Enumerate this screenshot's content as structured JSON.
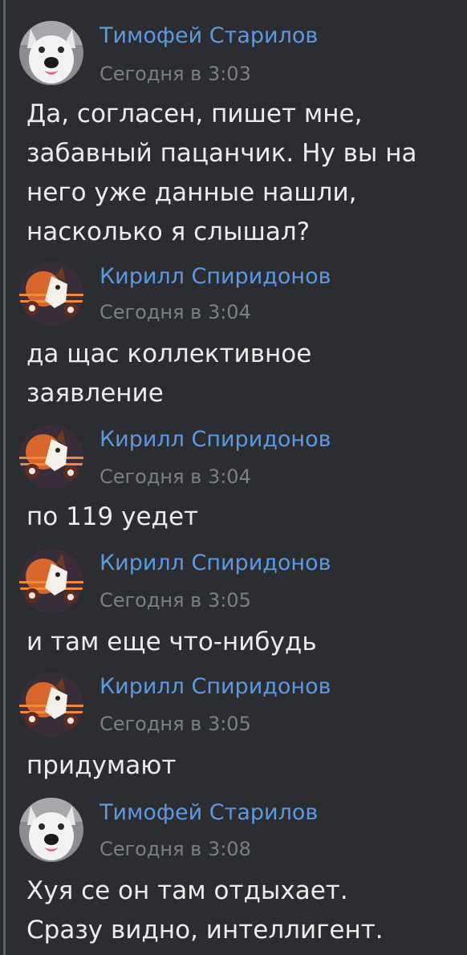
{
  "messages": [
    {
      "author": "Тимофей Старилов",
      "time": "Сегодня в 3:03",
      "text": "Да, согласен, пишет мне,\nзабавный пацанчик. Ну вы на\nнего уже данные нашли,\nнасколько я слышал?",
      "avatar": "husky-avatar"
    },
    {
      "author": "Кирилл Спиридонов",
      "time": "Сегодня в 3:04",
      "text": "да щас коллективное\nзаявление",
      "avatar": "fox-avatar"
    },
    {
      "author": "Кирилл Спиридонов",
      "time": "Сегодня в 3:04",
      "text": "по 119 уедет",
      "avatar": "fox-avatar"
    },
    {
      "author": "Кирилл Спиридонов",
      "time": "Сегодня в 3:05",
      "text": "и там еще что-нибудь",
      "avatar": "fox-avatar"
    },
    {
      "author": "Кирилл Спиридонов",
      "time": "Сегодня в 3:05",
      "text": "придумают",
      "avatar": "fox-avatar"
    },
    {
      "author": "Тимофей Старилов",
      "time": "Сегодня в 3:08",
      "text": "Хуя се он там отдыхает.\nСразу видно, интеллигент.",
      "avatar": "husky-avatar"
    }
  ],
  "colors": {
    "background": "#2c2d30",
    "author_link": "#5b9ae3",
    "timestamp": "#7c7f86",
    "message_text": "#ececed",
    "quote_bar": "#5f6268"
  }
}
